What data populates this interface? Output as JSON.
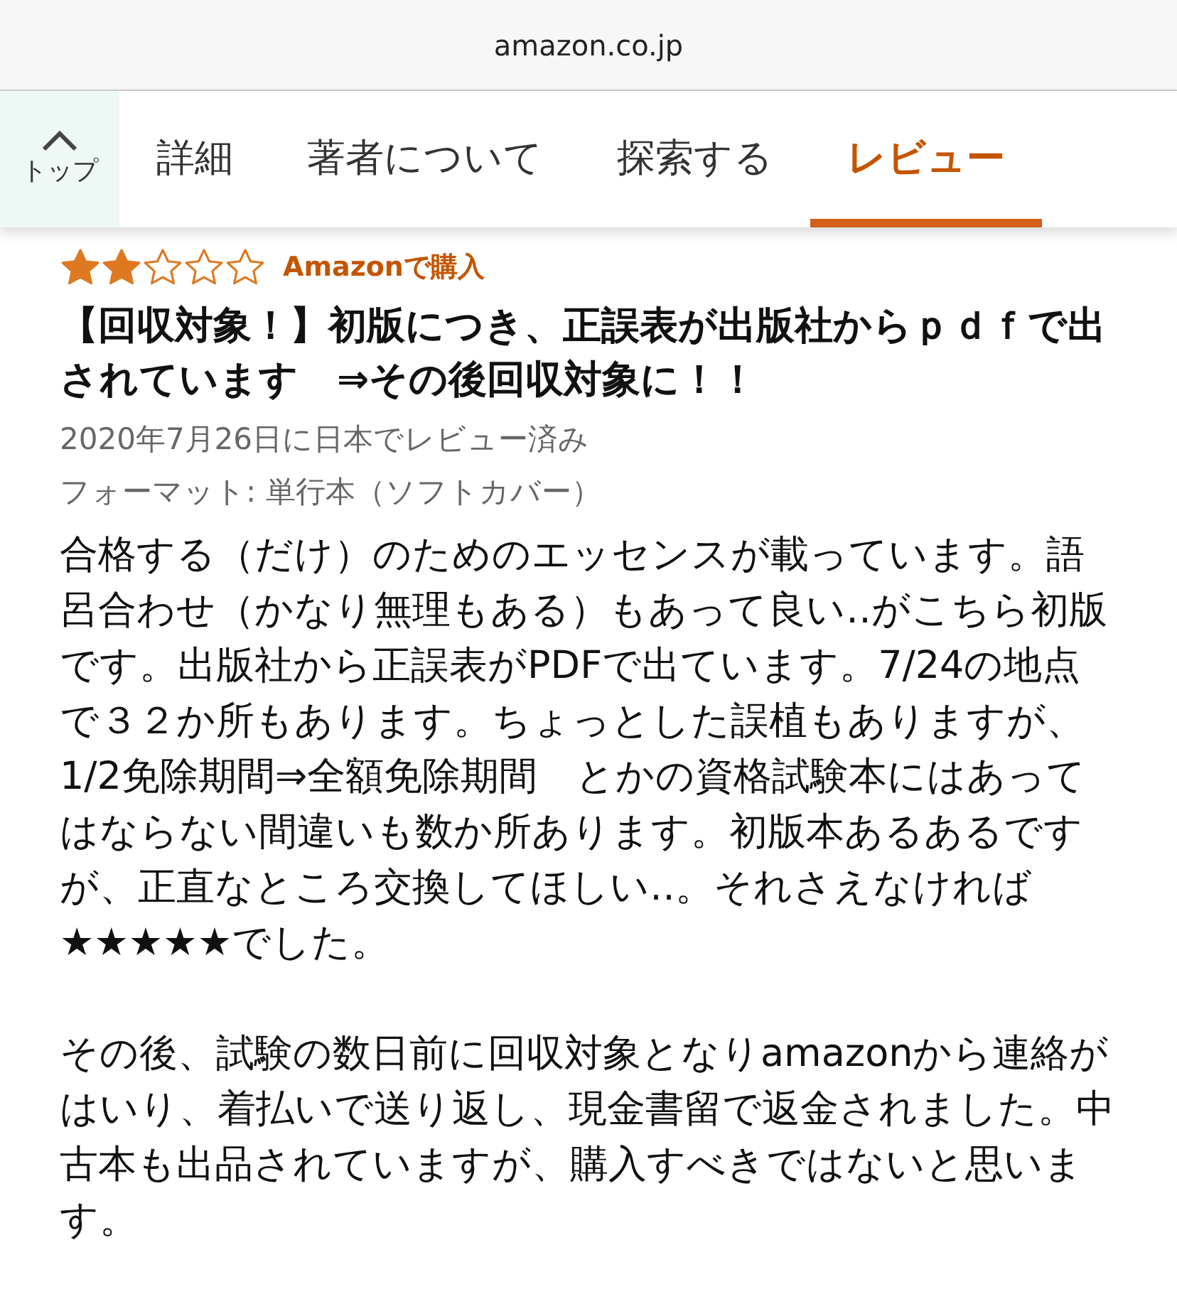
{
  "address_bar": {
    "url": "amazon.co.jp"
  },
  "top_button": {
    "label": "トップ"
  },
  "tabs": [
    {
      "label": "詳細",
      "selected": false
    },
    {
      "label": "著者について",
      "selected": false
    },
    {
      "label": "探索する",
      "selected": false
    },
    {
      "label": "レビュー",
      "selected": true
    }
  ],
  "review": {
    "stars": 2,
    "badge": "Amazonで購入",
    "title": "【回収対象！】初版につき、正誤表が出版社からｐｄｆで出されています　⇒その後回収対象に！！",
    "date": "2020年7月26日に日本でレビュー済み",
    "format": "フォーマット: 単行本（ソフトカバー）",
    "paragraphs": [
      "合格する（だけ）のためのエッセンスが載っています。語呂合わせ（かなり無理もある）もあって良い‥がこちら初版です。出版社から正誤表がPDFで出ています。7/24の地点で３２か所もあります。ちょっとした誤植もありますが、1/2免除期間⇒全額免除期間　とかの資格試験本にはあってはならない間違いも数か所あります。初版本あるあるですが、正直なところ交換してほしい‥。それさえなければ★★★★★でした。",
      "その後、試験の数日前に回収対象となりamazonから連絡がはいり、着払いで送り返し、現金書留で返金されました。中古本も出品されていますが、購入すべきではないと思います。"
    ]
  }
}
